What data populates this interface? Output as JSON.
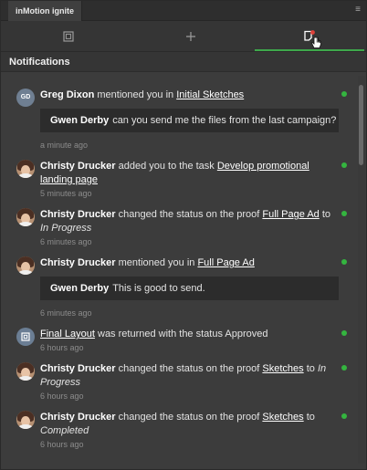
{
  "panel": {
    "tab_label": "inMotion ignite",
    "menu_icon": "hamburger-menu-icon"
  },
  "toolbar": {
    "icons": [
      "proof-icon",
      "plus-icon",
      "notification-icon"
    ],
    "active_tool": "notifications",
    "accent": "#3ea84b"
  },
  "section": {
    "title": "Notifications"
  },
  "notifications": [
    {
      "actor": "Greg Dixon",
      "initials": "GD",
      "text": "mentioned you in",
      "link": "Initial Sketches",
      "quote_author": "Gwen Derby",
      "quote_text": "can you send me the files from the last campaign?",
      "time": "a minute ago",
      "unread": true
    },
    {
      "actor": "Christy Drucker",
      "text": "added you to the task",
      "link": "Develop promotional landing page",
      "time": "5 minutes ago",
      "unread": true
    },
    {
      "actor": "Christy Drucker",
      "text": "changed the status on the proof",
      "link": "Full Page Ad",
      "mid": "to",
      "status": "In Progress",
      "time": "6 minutes ago",
      "unread": true
    },
    {
      "actor": "Christy Drucker",
      "text": "mentioned you in",
      "link": "Full Page Ad",
      "quote_author": "Gwen Derby",
      "quote_text": "This is good to send.",
      "time": "6 minutes ago",
      "unread": true
    },
    {
      "link": "Final Layout",
      "text": "was returned with the status Approved",
      "time": "6 hours ago",
      "unread": true
    },
    {
      "actor": "Christy Drucker",
      "text": "changed the status on the proof",
      "link": "Sketches",
      "mid": "to",
      "status": "In Progress",
      "time": "6 hours ago",
      "unread": true
    },
    {
      "actor": "Christy Drucker",
      "text": "changed the status on the proof",
      "link": "Sketches",
      "mid": "to",
      "status": "Completed",
      "time": "6 hours ago",
      "unread": true
    }
  ],
  "colors": {
    "unread_dot": "#34b53f",
    "background": "#3c3c3c",
    "quote_bg": "#2c2c2c"
  }
}
